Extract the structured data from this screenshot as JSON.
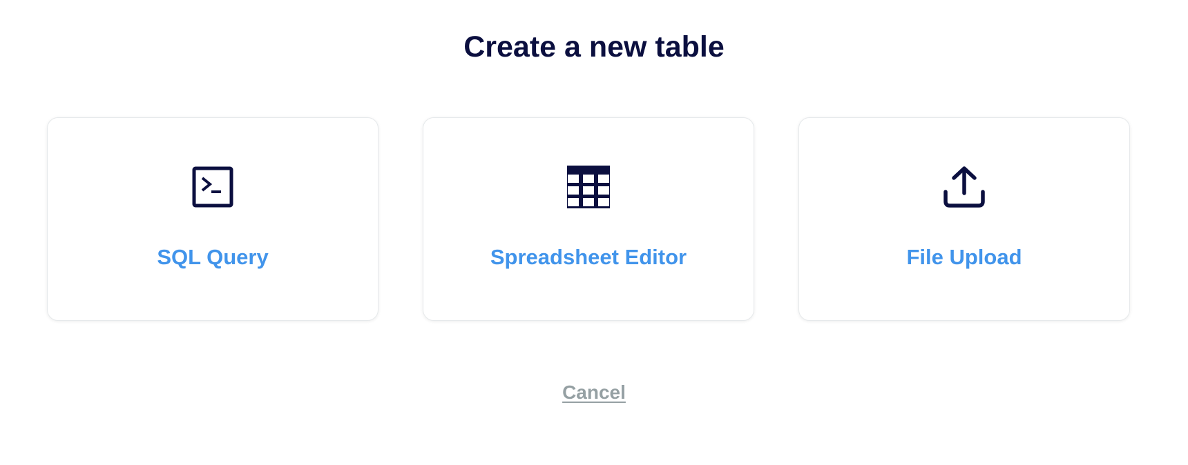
{
  "dialog": {
    "title": "Create a new table",
    "options": [
      {
        "label": "SQL Query",
        "icon": "terminal-icon"
      },
      {
        "label": "Spreadsheet Editor",
        "icon": "table-grid-icon"
      },
      {
        "label": "File Upload",
        "icon": "upload-icon"
      }
    ],
    "cancel_label": "Cancel"
  },
  "colors": {
    "title": "#0b0f3f",
    "accent": "#4194eb",
    "icon": "#0b0f3f",
    "cancel": "#95a0a3"
  }
}
